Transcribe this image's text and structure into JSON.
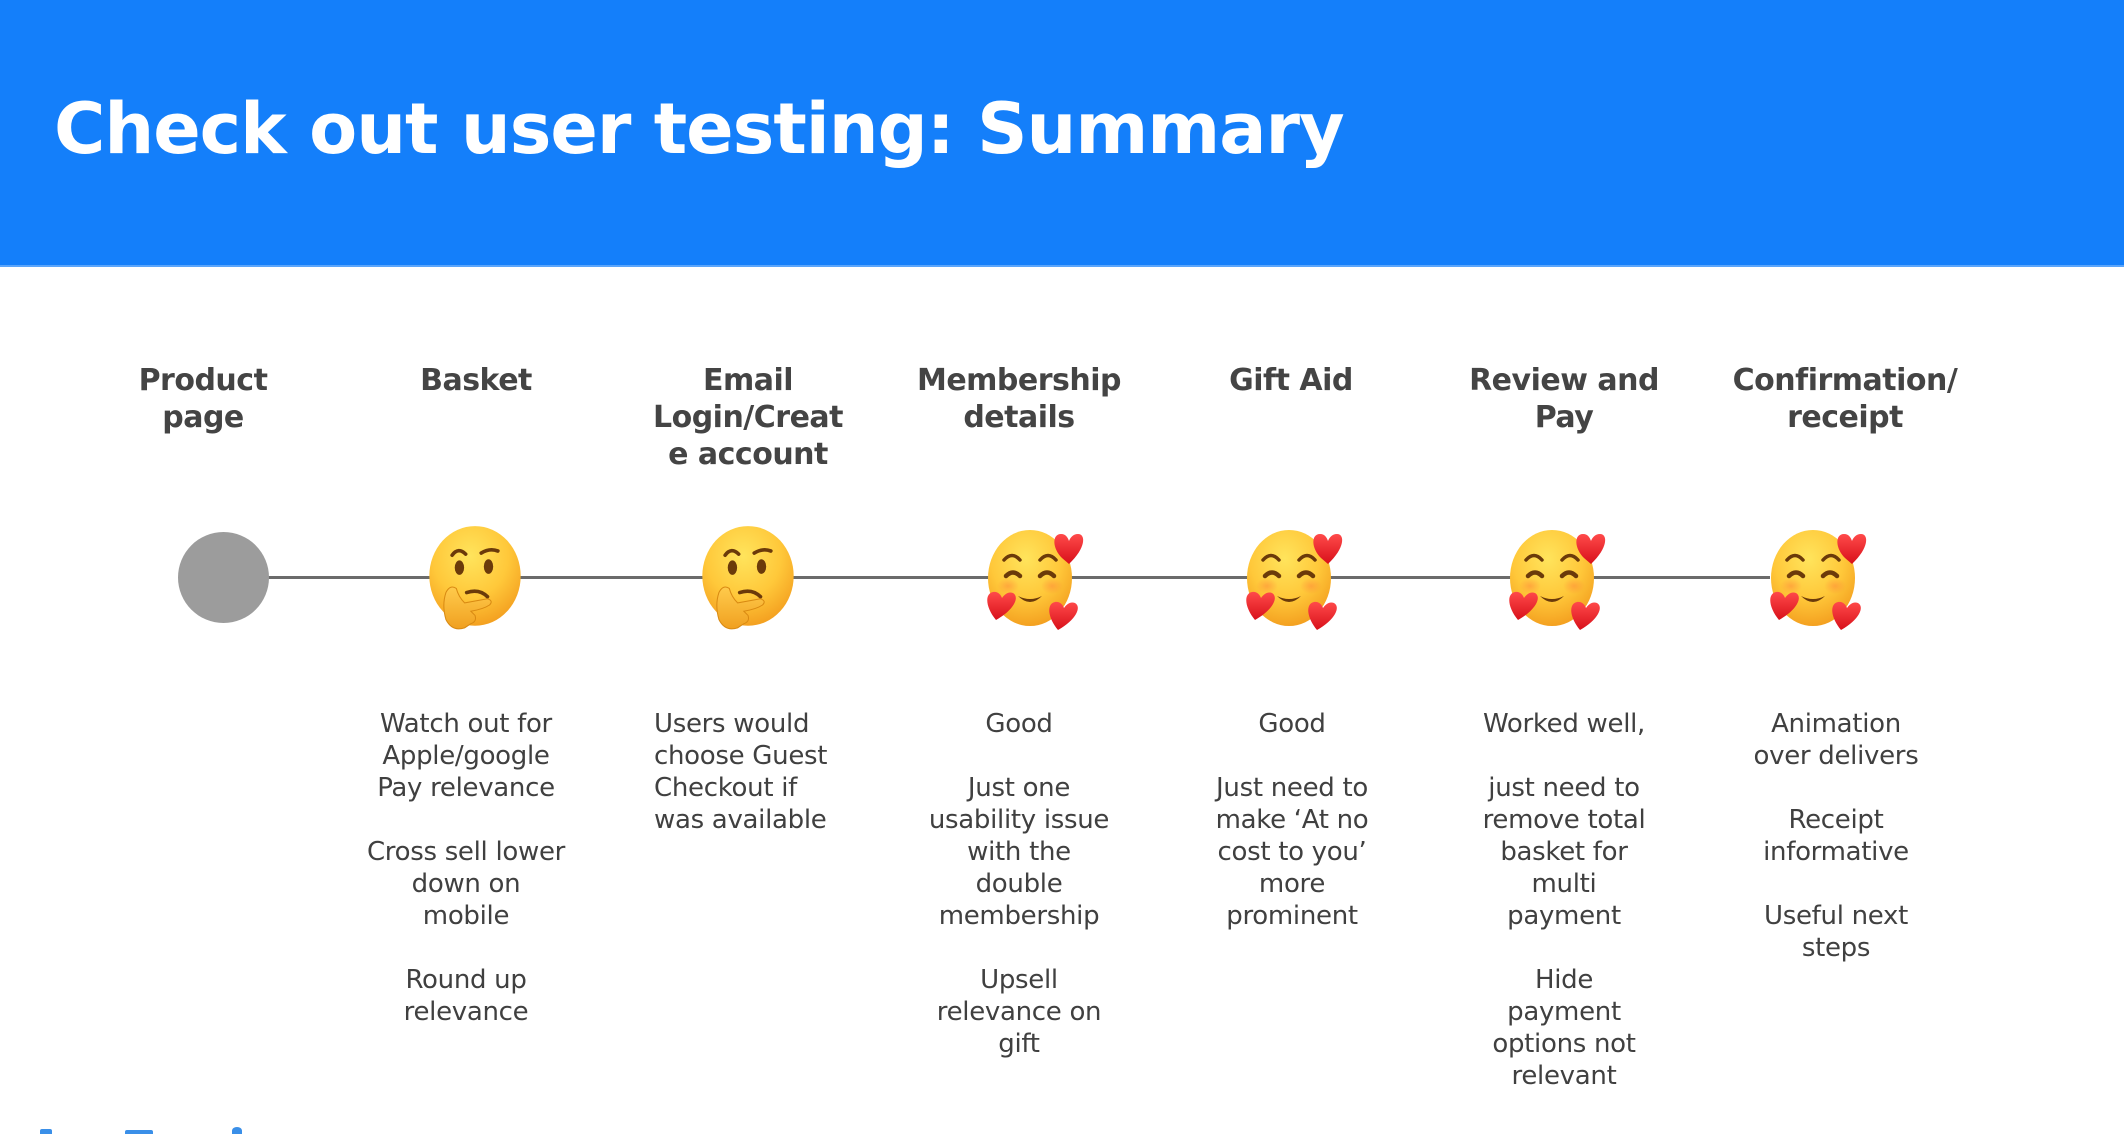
{
  "slide": {
    "title": "Check out user testing: Summary",
    "colors": {
      "header_bg": "#147FFA",
      "title_text": "#FFFFFF",
      "heading_text": "#444444",
      "body_text": "#404040",
      "timeline_line": "#6B6B6B",
      "start_node": "#9C9C9C"
    }
  },
  "stages": [
    {
      "heading": "Product\npage",
      "indicator": "start-node",
      "notes": []
    },
    {
      "heading": "Basket",
      "indicator": "thinking-face-icon",
      "notes": [
        "Watch out for\nApple/google\nPay relevance",
        "Cross sell lower\ndown on\nmobile",
        "Round up\nrelevance"
      ]
    },
    {
      "heading": "Email\nLogin/Creat\ne account",
      "indicator": "thinking-face-icon",
      "notes": [
        "Users would\nchoose Guest\nCheckout if\nwas available"
      ]
    },
    {
      "heading": "Membership\ndetails",
      "indicator": "smiling-face-with-hearts-icon",
      "notes": [
        "Good",
        "Just one\nusability issue\nwith the\ndouble\nmembership",
        "Upsell\nrelevance on\ngift"
      ]
    },
    {
      "heading": "Gift Aid",
      "indicator": "smiling-face-with-hearts-icon",
      "notes": [
        "Good",
        "Just need to\nmake ‘At no\ncost to you’\nmore\nprominent"
      ]
    },
    {
      "heading": "Review and\nPay",
      "indicator": "smiling-face-with-hearts-icon",
      "notes": [
        "Worked well,",
        "just need to\nremove total\nbasket for\nmulti\npayment",
        "Hide\npayment\noptions not\nrelevant"
      ]
    },
    {
      "heading": "Confirmation/\nreceipt",
      "indicator": "smiling-face-with-hearts-icon",
      "notes": [
        "Animation\nover delivers",
        "Receipt\ninformative",
        "Useful next\nsteps"
      ]
    }
  ]
}
